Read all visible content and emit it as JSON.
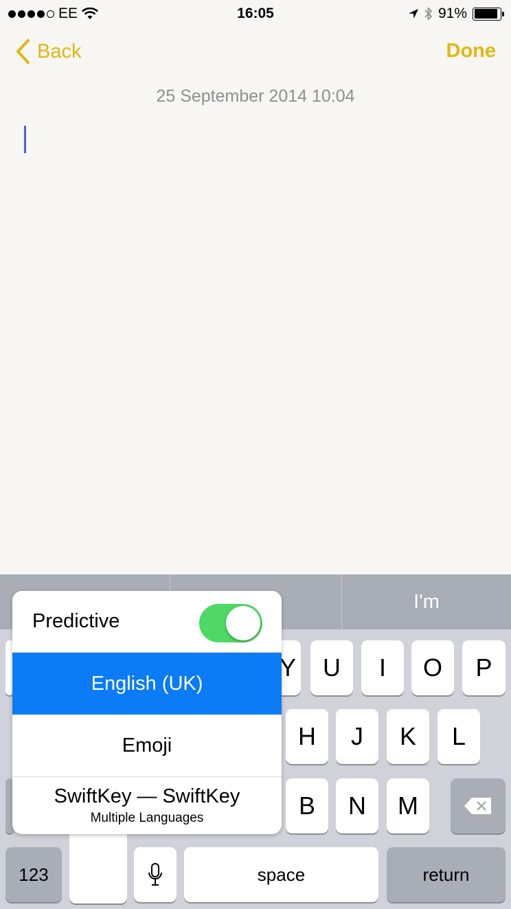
{
  "status_bar": {
    "carrier": "EE",
    "time": "16:05",
    "battery": "91%",
    "battery_level": 0.91
  },
  "nav": {
    "back_label": "Back",
    "done_label": "Done",
    "accent_color": "#e2b612"
  },
  "note": {
    "date": "25 September 2014 10:04"
  },
  "keyboard": {
    "prediction_right": "I'm",
    "row1": [
      "Y",
      "U",
      "I",
      "O",
      "P"
    ],
    "row2": [
      "H",
      "J",
      "K",
      "L"
    ],
    "row3": [
      "B",
      "N",
      "M"
    ],
    "numbers_label": "123",
    "space_label": "space",
    "return_label": "return"
  },
  "popup": {
    "predictive_label": "Predictive",
    "predictive_on": true,
    "selected_language": "English (UK)",
    "emoji_label": "Emoji",
    "swiftkey_title": "SwiftKey — SwiftKey",
    "swiftkey_sub": "Multiple Languages",
    "selected_color": "#0b7bf6"
  }
}
